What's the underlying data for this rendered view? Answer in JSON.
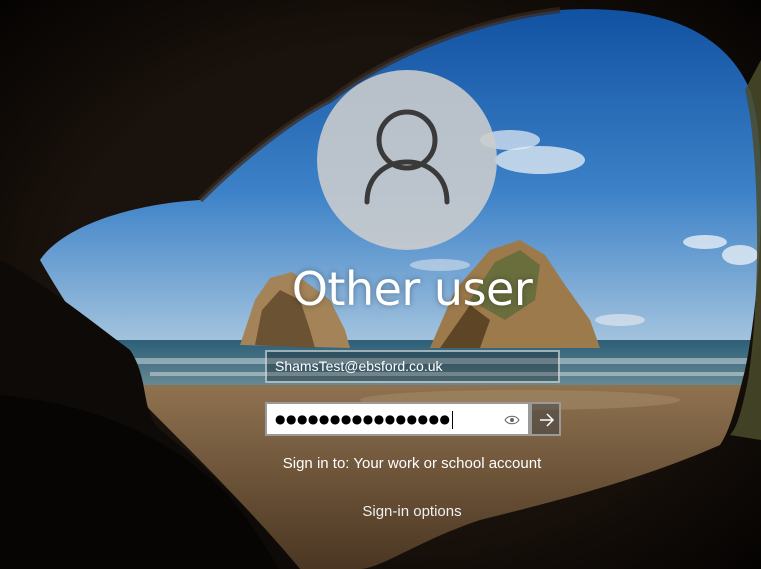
{
  "user": {
    "name": "Other user",
    "avatar_icon": "user-silhouette-icon"
  },
  "login": {
    "email_value": "ShamsTest@ebsford.co.uk",
    "password_masked": "●●●●●●●●●●●●●●●●",
    "reveal_icon": "eye-icon",
    "submit_icon": "arrow-right-icon"
  },
  "footer": {
    "sign_in_to": "Sign in to: Your work or school account",
    "sign_in_options": "Sign-in options"
  },
  "colors": {
    "sky": "#2f6fb8",
    "sea": "#3a6f86",
    "sand": "#8a6a45",
    "cave": "#120d0a",
    "text": "#ffffff"
  }
}
